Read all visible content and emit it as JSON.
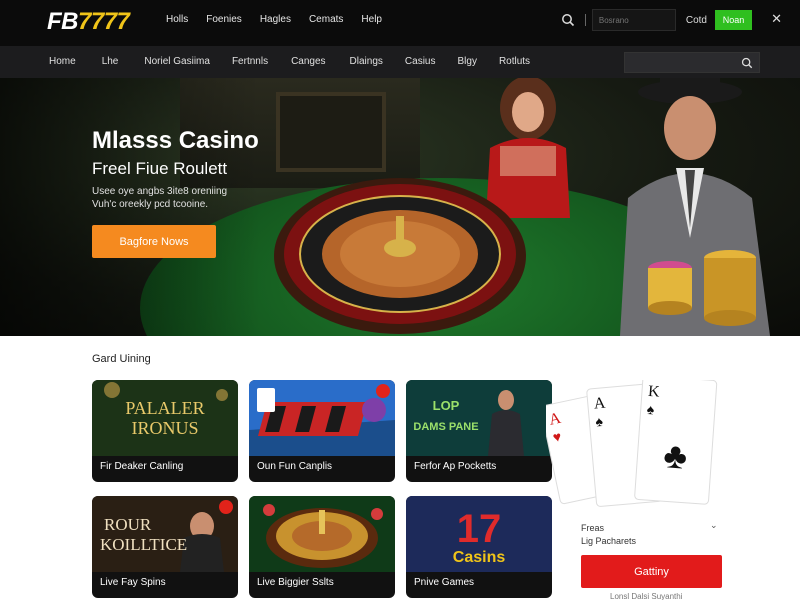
{
  "logo": {
    "fb": "FB",
    "num": "7777"
  },
  "top_nav": [
    "Holls",
    "Foenies",
    "Hagles",
    "Cemats",
    "Help"
  ],
  "top_right": {
    "search_placeholder": "Bosrano",
    "login_label": "Cotd",
    "register_label": "Noan",
    "close_glyph": "✕",
    "register_color": "#2fbf1f"
  },
  "main_nav": [
    "Home",
    "Lhe",
    "Noriel Gasiima",
    "Fertnnls",
    "Canges",
    "Dlaings",
    "Casius",
    "Blgy",
    "Rotluts"
  ],
  "hero": {
    "title": "Mlasss Casino",
    "subtitle": "Freel Fiue Roulett",
    "description": "Usee oye angbs 3ite8 oreniing\nVuh'c oreekly pcd tcooine.",
    "cta_label": "Bagfore Nows",
    "cta_color": "#f58a1f"
  },
  "section": {
    "title": "Gard Uining"
  },
  "games": [
    {
      "title": "Fir Deaker Canling",
      "art_text_1": "PALALER",
      "art_text_2": "IRONUS",
      "badge": false
    },
    {
      "title": "Oun Fun Canplis",
      "art_text_1": "",
      "art_text_2": "",
      "badge": true
    },
    {
      "title": "Ferfor Ap Pocketts",
      "art_text_1": "LOP",
      "art_text_2": "DAMS PANE",
      "badge": false
    },
    {
      "title": "Live Fay Spins",
      "art_text_1": "ROUR",
      "art_text_2": "KOILLTICE",
      "badge": true
    },
    {
      "title": "Live Biggier Sslts",
      "art_text_1": "",
      "art_text_2": "",
      "badge": false
    },
    {
      "title": "Pnive Games",
      "art_text_1": "17",
      "art_text_2": "Casins",
      "badge": false
    }
  ],
  "promo": {
    "title": "Freas",
    "subtitle": "Lig Pacharets",
    "chevron": "⌄",
    "button_label": "Gattiny",
    "button_color": "#e21b1b",
    "footer": "Lonsl Dalsi Suyanthi",
    "cards": [
      "A",
      "A",
      "K"
    ]
  },
  "icons": [
    "search-icon",
    "close-icon",
    "chevron-down-icon",
    "club-icon",
    "spade-icon",
    "heart-icon"
  ]
}
